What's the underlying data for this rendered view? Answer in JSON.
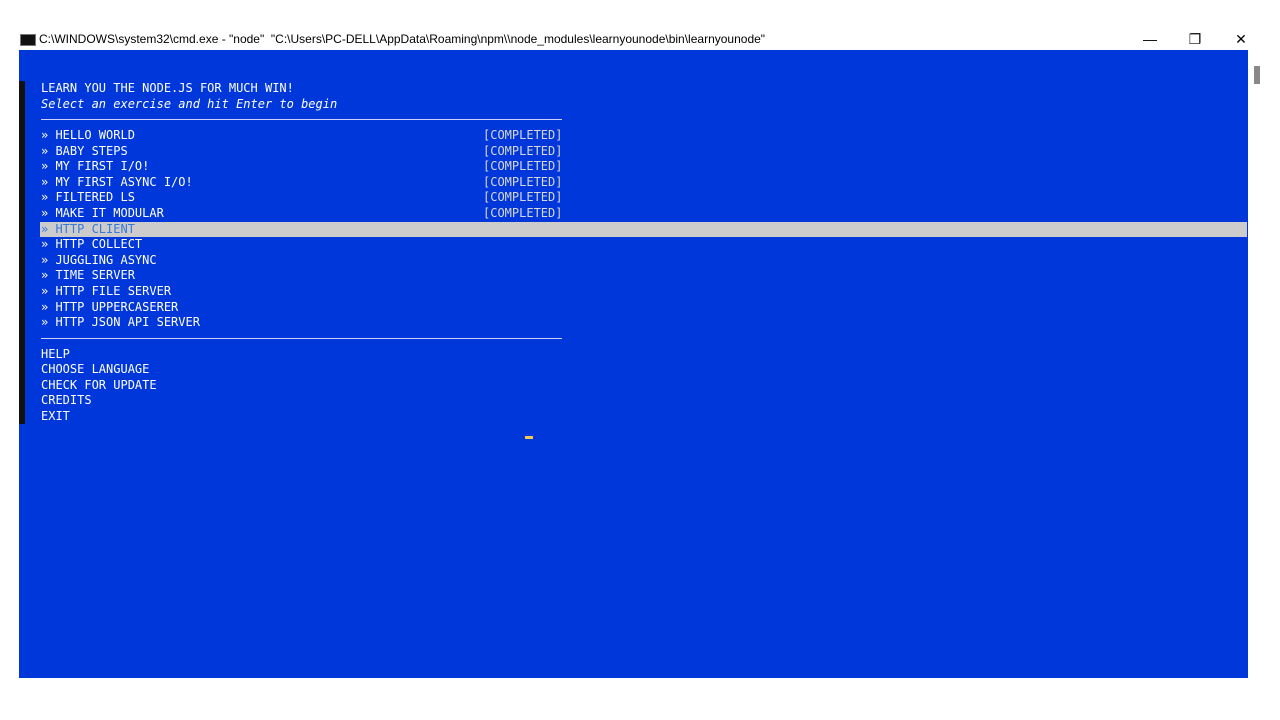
{
  "window": {
    "title": "C:\\WINDOWS\\system32\\cmd.exe - \"node\"  \"C:\\Users\\PC-DELL\\AppData\\Roaming\\npm\\\\node_modules\\learnyounode\\bin\\learnyounode\"",
    "minimize": "—",
    "restore": "❐",
    "close": "✕"
  },
  "header": {
    "title": "LEARN YOU THE NODE.JS FOR MUCH WIN!",
    "subtitle": "Select an exercise and hit Enter to begin"
  },
  "exercises": [
    {
      "label": "» HELLO WORLD",
      "status": "[COMPLETED]"
    },
    {
      "label": "» BABY STEPS",
      "status": "[COMPLETED]"
    },
    {
      "label": "» MY FIRST I/O!",
      "status": "[COMPLETED]"
    },
    {
      "label": "» MY FIRST ASYNC I/O!",
      "status": "[COMPLETED]"
    },
    {
      "label": "» FILTERED LS",
      "status": "[COMPLETED]"
    },
    {
      "label": "» MAKE IT MODULAR",
      "status": "[COMPLETED]"
    },
    {
      "label": "» HTTP CLIENT",
      "status": ""
    },
    {
      "label": "» HTTP COLLECT",
      "status": ""
    },
    {
      "label": "» JUGGLING ASYNC",
      "status": ""
    },
    {
      "label": "» TIME SERVER",
      "status": ""
    },
    {
      "label": "» HTTP FILE SERVER",
      "status": ""
    },
    {
      "label": "» HTTP UPPERCASERER",
      "status": ""
    },
    {
      "label": "» HTTP JSON API SERVER",
      "status": ""
    }
  ],
  "menu": [
    "HELP",
    "CHOOSE LANGUAGE",
    "CHECK FOR UPDATE",
    "CREDITS",
    "EXIT"
  ]
}
